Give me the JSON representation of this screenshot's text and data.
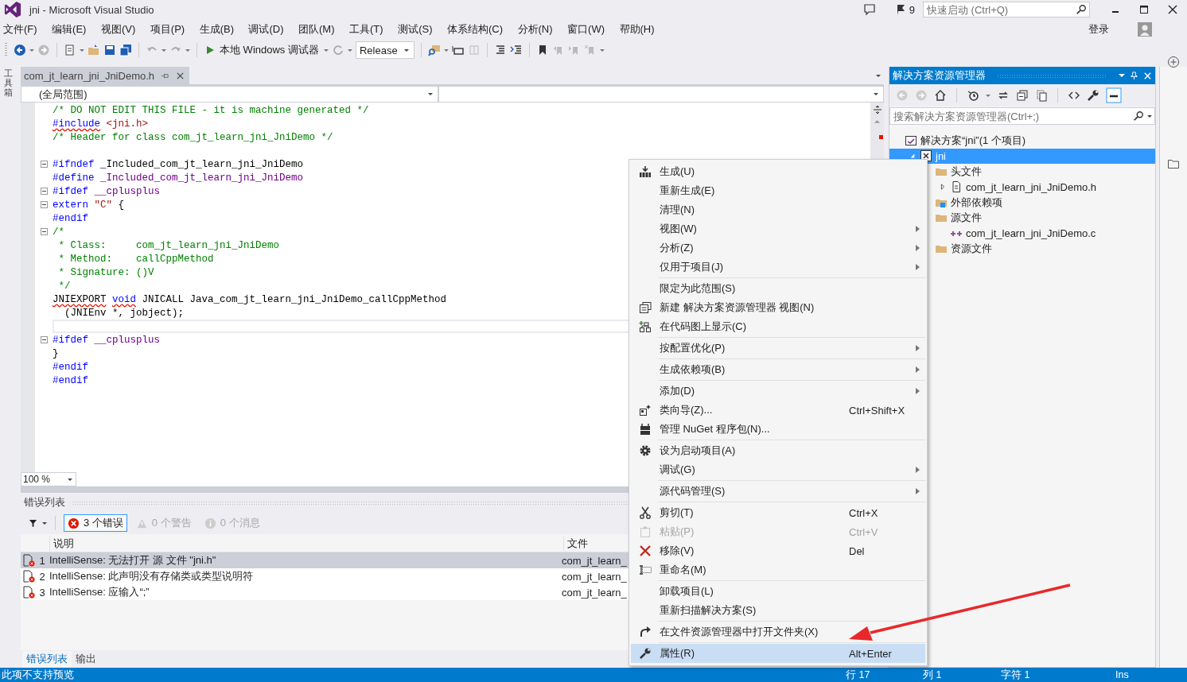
{
  "window": {
    "title": "jni - Microsoft Visual Studio"
  },
  "title_bar": {
    "notification_count": "9",
    "quick_launch": {
      "placeholder": "快速启动 (Ctrl+Q)"
    }
  },
  "menu_bar": {
    "items": [
      "文件(F)",
      "编辑(E)",
      "视图(V)",
      "项目(P)",
      "生成(B)",
      "调试(D)",
      "团队(M)",
      "工具(T)",
      "测试(S)",
      "体系结构(C)",
      "分析(N)",
      "窗口(W)",
      "帮助(H)"
    ],
    "sign_in": "登录"
  },
  "toolbar": {
    "debugger": "本地 Windows 调试器",
    "configuration": "Release"
  },
  "toolbox_strip": {
    "label": "工具箱"
  },
  "editor": {
    "tab": "com_jt_learn_jni_JniDemo.h",
    "scope": "(全局范围)",
    "zoom": "100 %",
    "lines": [
      {
        "fold": false,
        "current": false,
        "tokens": [
          {
            "kind": "comment",
            "text": "/* DO NOT EDIT THIS FILE - it is machine generated */"
          }
        ]
      },
      {
        "fold": false,
        "current": false,
        "tokens": [
          {
            "kind": "error_keyword",
            "text": "#include"
          },
          {
            "kind": "string",
            "text": " <jni.h>"
          }
        ]
      },
      {
        "fold": false,
        "current": false,
        "tokens": [
          {
            "kind": "comment",
            "text": "/* Header for class com_jt_learn_jni_JniDemo */"
          }
        ]
      },
      {
        "fold": false,
        "current": false
      },
      {
        "fold": true,
        "current": false,
        "tokens": [
          {
            "kind": "keyword",
            "text": "#ifndef"
          },
          {
            "kind": "plain",
            "text": " _Included_com_jt_learn_jni_JniDemo"
          }
        ]
      },
      {
        "fold": false,
        "current": false,
        "tokens": [
          {
            "kind": "keyword",
            "text": "#define"
          },
          {
            "kind": "macro",
            "text": " _Included_com_jt_learn_jni_JniDemo"
          }
        ]
      },
      {
        "fold": true,
        "current": false,
        "tokens": [
          {
            "kind": "keyword",
            "text": "#ifdef"
          },
          {
            "kind": "macro",
            "text": " __cplusplus"
          }
        ]
      },
      {
        "fold": true,
        "current": false,
        "tokens": [
          {
            "kind": "keyword",
            "text": "extern"
          },
          {
            "kind": "string",
            "text": " \"C\""
          },
          {
            "kind": "plain",
            "text": " {"
          }
        ]
      },
      {
        "fold": false,
        "current": false,
        "tokens": [
          {
            "kind": "keyword",
            "text": "#endif"
          }
        ]
      },
      {
        "fold": true,
        "current": false,
        "tokens": [
          {
            "kind": "comment",
            "text": "/*"
          }
        ]
      },
      {
        "fold": false,
        "current": false,
        "tokens": [
          {
            "kind": "comment",
            "text": " * Class:     com_jt_learn_jni_JniDemo"
          }
        ]
      },
      {
        "fold": false,
        "current": false,
        "tokens": [
          {
            "kind": "comment",
            "text": " * Method:    callCppMethod"
          }
        ]
      },
      {
        "fold": false,
        "current": false,
        "tokens": [
          {
            "kind": "comment",
            "text": " * Signature: ()V"
          }
        ]
      },
      {
        "fold": false,
        "current": false,
        "tokens": [
          {
            "kind": "comment",
            "text": " */"
          }
        ]
      },
      {
        "fold": false,
        "current": false,
        "tokens": [
          {
            "kind": "error_plain",
            "text": "JNIEXPORT"
          },
          {
            "kind": "error_keyword",
            "text": " void"
          },
          {
            "kind": "plain",
            "text": " JNICALL Java_com_jt_learn_jni_JniDemo_callCppMethod"
          }
        ]
      },
      {
        "fold": false,
        "current": false,
        "tokens": [
          {
            "kind": "plain",
            "text": "  (JNIEnv *, jobject);"
          }
        ]
      },
      {
        "fold": false,
        "current": true
      },
      {
        "fold": true,
        "current": false,
        "tokens": [
          {
            "kind": "keyword",
            "text": "#ifdef"
          },
          {
            "kind": "macro",
            "text": " __cplusplus"
          }
        ]
      },
      {
        "fold": false,
        "current": false,
        "tokens": [
          {
            "kind": "plain",
            "text": "}"
          }
        ]
      },
      {
        "fold": false,
        "current": false,
        "tokens": [
          {
            "kind": "keyword",
            "text": "#endif"
          }
        ]
      },
      {
        "fold": false,
        "current": false,
        "tokens": [
          {
            "kind": "keyword",
            "text": "#endif"
          }
        ]
      }
    ]
  },
  "error_list": {
    "title": "错误列表",
    "filters": [
      {
        "kind": "error",
        "label": "3 个错误",
        "selected": true
      },
      {
        "kind": "warning",
        "label": "0 个警告",
        "selected": false
      },
      {
        "kind": "info",
        "label": "0 个消息",
        "selected": false
      }
    ],
    "columns": [
      "说明",
      "文件"
    ],
    "rows": [
      {
        "index": "1",
        "description": "IntelliSense:  无法打开 源 文件 \"jni.h\"",
        "file": "com_jt_learn_",
        "selected": true
      },
      {
        "index": "2",
        "description": "IntelliSense:  此声明没有存储类或类型说明符",
        "file": "com_jt_learn_",
        "selected": false
      },
      {
        "index": "3",
        "description": "IntelliSense:  应输入“;”",
        "file": "com_jt_learn_",
        "selected": false
      }
    ],
    "tabs": [
      {
        "label": "错误列表",
        "selected": true
      },
      {
        "label": "输出",
        "selected": false
      }
    ]
  },
  "solution_explorer": {
    "title": "解决方案资源管理器",
    "search": {
      "placeholder": "搜索解决方案资源管理器(Ctrl+;)"
    },
    "tree": [
      {
        "kind": "solution",
        "label": "解决方案“jni”(1 个项目)",
        "selected": false,
        "children": [
          {
            "kind": "project",
            "label": "jni",
            "selected": true,
            "expanded": true,
            "children": [
              {
                "kind": "folder",
                "label": "头文件",
                "selected": false,
                "children": [
                  {
                    "kind": "header",
                    "label": "com_jt_learn_jni_JniDemo.h",
                    "selected": false,
                    "expanded": false
                  }
                ]
              },
              {
                "kind": "deps",
                "label": "外部依赖项",
                "selected": false
              },
              {
                "kind": "folder",
                "label": "源文件",
                "selected": false,
                "children": [
                  {
                    "kind": "source",
                    "label": "com_jt_learn_jni_JniDemo.c",
                    "selected": false
                  }
                ]
              },
              {
                "kind": "folder",
                "label": "资源文件",
                "selected": false
              }
            ]
          }
        ]
      }
    ]
  },
  "context_menu": {
    "groups": [
      {
        "items": [
          {
            "kind": "build",
            "label": "生成(U)",
            "submenu": false,
            "disabled": false,
            "selected": false
          },
          {
            "kind": "text",
            "label": "重新生成(E)",
            "submenu": false,
            "disabled": false,
            "selected": false
          },
          {
            "kind": "text",
            "label": "清理(N)",
            "submenu": false,
            "disabled": false,
            "selected": false
          },
          {
            "kind": "text",
            "label": "视图(W)",
            "submenu": true,
            "disabled": false,
            "selected": false
          },
          {
            "kind": "text",
            "label": "分析(Z)",
            "submenu": true,
            "disabled": false,
            "selected": false
          },
          {
            "kind": "text",
            "label": "仅用于项目(J)",
            "submenu": true,
            "disabled": false,
            "selected": false
          }
        ]
      },
      {
        "items": [
          {
            "kind": "text",
            "label": "限定为此范围(S)",
            "submenu": false,
            "disabled": false,
            "selected": false
          },
          {
            "kind": "new_view",
            "label": "新建 解决方案资源管理器 视图(N)",
            "submenu": false,
            "disabled": false,
            "selected": false
          },
          {
            "kind": "code_map",
            "label": "在代码图上显示(C)",
            "submenu": false,
            "disabled": false,
            "selected": false
          }
        ]
      },
      {
        "items": [
          {
            "kind": "text",
            "label": "按配置优化(P)",
            "submenu": true,
            "disabled": false,
            "selected": false
          }
        ]
      },
      {
        "items": [
          {
            "kind": "text",
            "label": "生成依赖项(B)",
            "submenu": true,
            "disabled": false,
            "selected": false
          }
        ]
      },
      {
        "items": [
          {
            "kind": "text",
            "label": "添加(D)",
            "submenu": true,
            "disabled": false,
            "selected": false
          },
          {
            "kind": "wizard",
            "label": "类向导(Z)...",
            "shortcut": "Ctrl+Shift+X",
            "submenu": false,
            "disabled": false,
            "selected": false
          },
          {
            "kind": "package",
            "label": "管理 NuGet 程序包(N)...",
            "submenu": false,
            "disabled": false,
            "selected": false
          }
        ]
      },
      {
        "items": [
          {
            "kind": "gear",
            "label": "设为启动项目(A)",
            "submenu": false,
            "disabled": false,
            "selected": false
          },
          {
            "kind": "text",
            "label": "调试(G)",
            "submenu": true,
            "disabled": false,
            "selected": false
          }
        ]
      },
      {
        "items": [
          {
            "kind": "text",
            "label": "源代码管理(S)",
            "submenu": true,
            "disabled": false,
            "selected": false
          }
        ]
      },
      {
        "items": [
          {
            "kind": "scissors",
            "label": "剪切(T)",
            "shortcut": "Ctrl+X",
            "submenu": false,
            "disabled": false,
            "selected": false
          },
          {
            "kind": "paste",
            "label": "粘贴(P)",
            "shortcut": "Ctrl+V",
            "submenu": false,
            "disabled": true,
            "selected": false
          },
          {
            "kind": "remove",
            "label": "移除(V)",
            "shortcut": "Del",
            "submenu": false,
            "disabled": false,
            "selected": false
          },
          {
            "kind": "rename",
            "label": "重命名(M)",
            "submenu": false,
            "disabled": false,
            "selected": false
          }
        ]
      },
      {
        "items": [
          {
            "kind": "text",
            "label": "卸载项目(L)",
            "submenu": false,
            "disabled": false,
            "selected": false
          },
          {
            "kind": "text",
            "label": "重新扫描解决方案(S)",
            "submenu": false,
            "disabled": false,
            "selected": false
          }
        ]
      },
      {
        "items": [
          {
            "kind": "open_folder",
            "label": "在文件资源管理器中打开文件夹(X)",
            "submenu": false,
            "disabled": false,
            "selected": false
          }
        ]
      },
      {
        "items": [
          {
            "kind": "wrench",
            "label": "属性(R)",
            "shortcut": "Alt+Enter",
            "submenu": false,
            "disabled": false,
            "selected": true
          }
        ]
      }
    ]
  },
  "status_bar": {
    "message": "此项不支持预览",
    "line": "行 17",
    "column": "列 1",
    "char": "字符 1",
    "mode": "Ins"
  }
}
